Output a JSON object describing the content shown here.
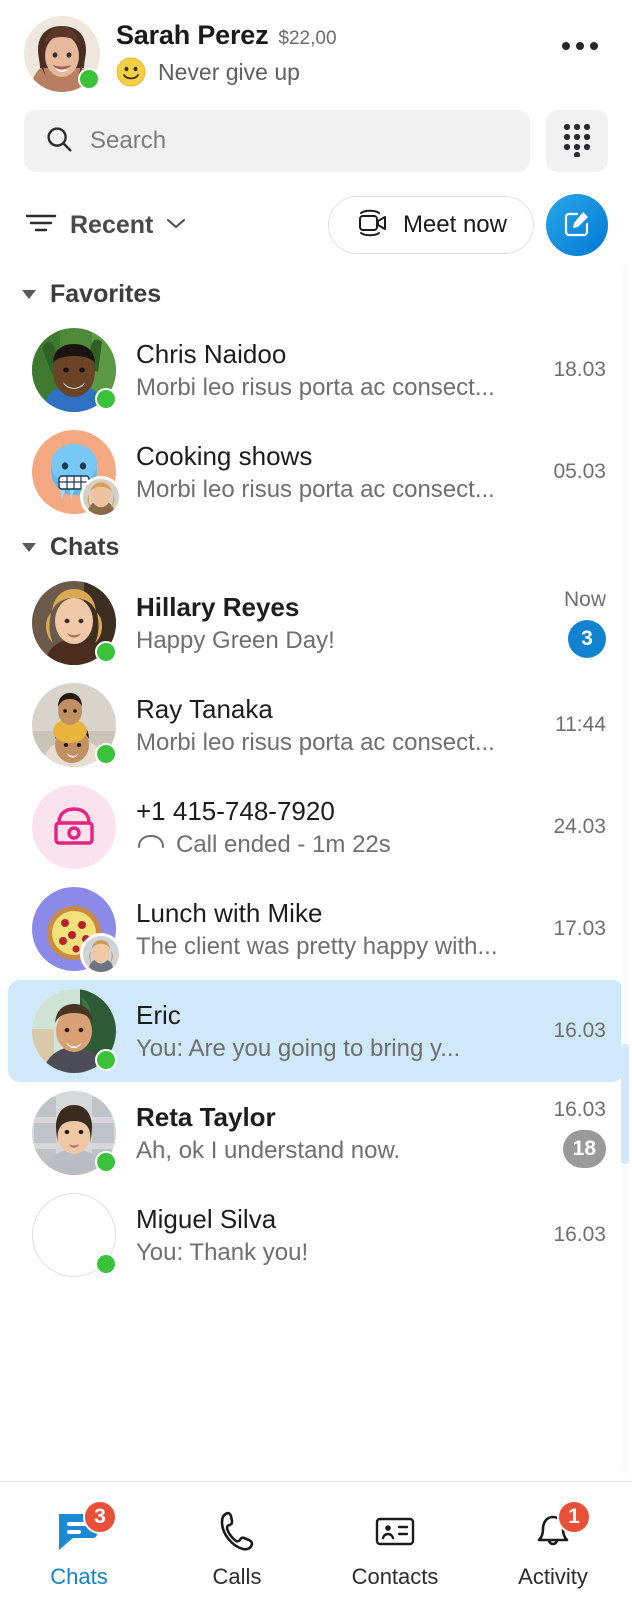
{
  "header": {
    "name": "Sarah Perez",
    "balance": "$22,00",
    "mood": "Never give up",
    "mood_emoji": "smiley-emoji",
    "more_label": "•••"
  },
  "search": {
    "placeholder": "Search",
    "value": "",
    "icon": "search-icon",
    "dialpad_icon": "dialpad-icon"
  },
  "toolbar": {
    "filter_label": "Recent",
    "filter_icon": "filter-icon",
    "chevron_icon": "chevron-down-icon",
    "meet_label": "Meet now",
    "meet_icon": "video-camera-icon",
    "compose_icon": "compose-pencil-icon"
  },
  "sections": [
    {
      "id": "favorites",
      "title": "Favorites",
      "expanded": true,
      "items": [
        {
          "name": "Chris Naidoo",
          "preview": "Morbi leo risus porta ac consect...",
          "time": "18.03",
          "unread": false,
          "badge": "",
          "badge_color": "",
          "presence": "online",
          "avatar": "chris-photo",
          "mini_avatar": ""
        },
        {
          "name": "Cooking shows",
          "preview": "Morbi leo risus porta ac consect...",
          "time": "05.03",
          "unread": false,
          "badge": "",
          "badge_color": "",
          "presence": "",
          "avatar": "cooking-emoji",
          "mini_avatar": "woman-mini"
        }
      ]
    },
    {
      "id": "chats",
      "title": "Chats",
      "expanded": true,
      "items": [
        {
          "name": "Hillary Reyes",
          "preview": "Happy Green Day!",
          "time": "Now",
          "unread": true,
          "badge": "3",
          "badge_color": "#0f82d0",
          "presence": "online",
          "avatar": "hillary-photo",
          "mini_avatar": ""
        },
        {
          "name": "Ray Tanaka",
          "preview": "Morbi leo risus porta ac consect...",
          "time": "11:44",
          "unread": false,
          "badge": "",
          "badge_color": "",
          "presence": "online",
          "avatar": "ray-photo",
          "mini_avatar": ""
        },
        {
          "name": "+1 415-748-7920",
          "preview": "Call ended - 1m 22s",
          "preview_icon": "call-ended-icon",
          "time": "24.03",
          "unread": false,
          "badge": "",
          "badge_color": "",
          "presence": "",
          "avatar": "phone-icon-avatar",
          "mini_avatar": ""
        },
        {
          "name": "Lunch with Mike",
          "preview": "The client was pretty happy with...",
          "time": "17.03",
          "unread": false,
          "badge": "",
          "badge_color": "",
          "presence": "",
          "avatar": "pizza-emoji",
          "mini_avatar": "woman2-mini"
        },
        {
          "name": "Eric",
          "preview": "You: Are you going to bring y...",
          "time": "16.03",
          "unread": false,
          "selected": true,
          "badge": "",
          "badge_color": "",
          "presence": "online",
          "avatar": "eric-photo",
          "mini_avatar": ""
        },
        {
          "name": "Reta Taylor",
          "preview": "Ah, ok I understand now.",
          "time": "16.03",
          "unread": true,
          "badge": "18",
          "badge_color": "#9a9a9a",
          "presence": "online",
          "avatar": "reta-photo",
          "mini_avatar": ""
        },
        {
          "name": "Miguel Silva",
          "preview": "You: Thank you!",
          "time": "16.03",
          "unread": false,
          "badge": "",
          "badge_color": "",
          "presence": "online",
          "avatar": "empty-avatar",
          "mini_avatar": ""
        }
      ]
    }
  ],
  "bottom_nav": {
    "items": [
      {
        "label": "Chats",
        "icon": "chat-bubble-icon",
        "badge": "3",
        "active": true
      },
      {
        "label": "Calls",
        "icon": "phone-handset-icon",
        "badge": "",
        "active": false
      },
      {
        "label": "Contacts",
        "icon": "contact-card-icon",
        "badge": "",
        "active": false
      },
      {
        "label": "Activity",
        "icon": "bell-icon",
        "badge": "1",
        "active": false
      }
    ]
  },
  "colors": {
    "accent": "#0f82d0",
    "selected_row": "#cfe9fb",
    "presence_online": "#3ac23a",
    "badge_red": "#e8503a",
    "badge_grey": "#9a9a9a",
    "search_bg": "#f1f1f1"
  }
}
